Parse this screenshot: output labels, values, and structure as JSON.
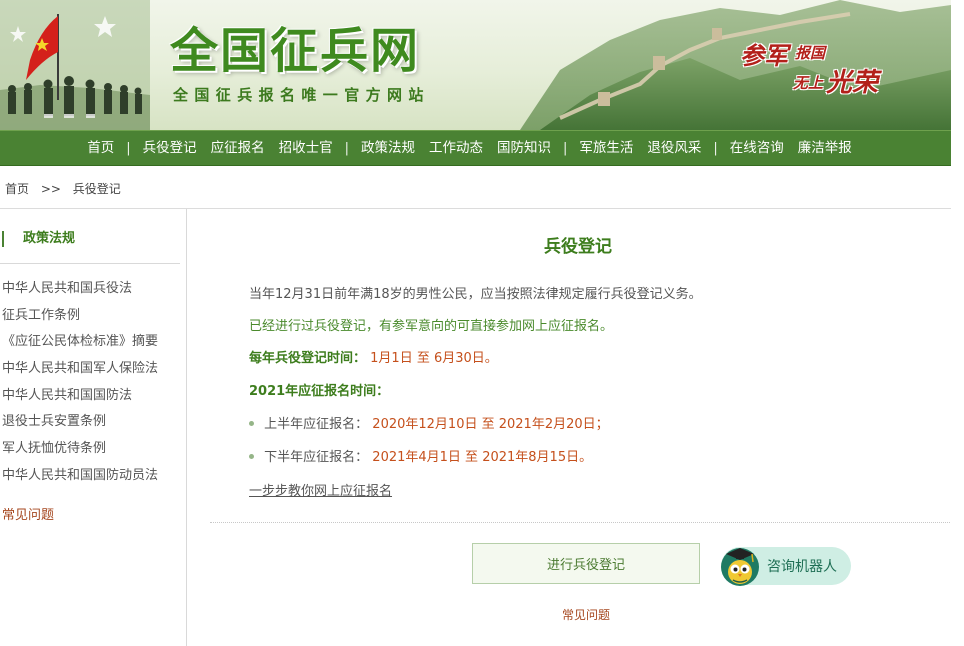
{
  "header": {
    "site_title": "全国征兵网",
    "site_subtitle": "全国征兵报名唯一官方网站",
    "slogan": {
      "part1": "参军",
      "part2": "报国",
      "part3": "无上",
      "part4": "光荣"
    }
  },
  "nav": {
    "items": [
      "首页",
      "兵役登记",
      "应征报名",
      "招收士官",
      "政策法规",
      "工作动态",
      "国防知识",
      "军旅生活",
      "退役风采",
      "在线咨询",
      "廉洁举报"
    ],
    "separator": "|"
  },
  "breadcrumb": {
    "home": "首页",
    "separator": ">>",
    "current": "兵役登记"
  },
  "sidebar": {
    "title": "政策法规",
    "items": [
      "中华人民共和国兵役法",
      "征兵工作条例",
      "《应征公民体检标准》摘要",
      "中华人民共和国军人保险法",
      "中华人民共和国国防法",
      "退役士兵安置条例",
      "军人抚恤优待条例",
      "中华人民共和国国防动员法"
    ],
    "faq": "常见问题"
  },
  "main": {
    "title": "兵役登记",
    "para1": "当年12月31日前年满18岁的男性公民，应当按照法律规定履行兵役登记义务。",
    "para2": "已经进行过兵役登记，有参军意向的可直接参加网上应征报名。",
    "registration_time_label": "每年兵役登记时间：",
    "registration_time_value": "1月1日 至 6月30日。",
    "enlist_time_heading": "2021年应征报名时间：",
    "first_half_label": "上半年应征报名：",
    "first_half_value": "2020年12月10日 至 2021年2月20日；",
    "second_half_label": "下半年应征报名：",
    "second_half_value": "2021年4月1日 至 2021年8月15日。",
    "guide_link": "一步步教你网上应征报名",
    "register_button": "进行兵役登记",
    "robot_button": "咨询机器人",
    "bottom_faq": "常见问题"
  },
  "colors": {
    "nav_bg": "#4a8233",
    "title_green": "#3d7d1d",
    "date_orange": "#c5501c",
    "faq_brown": "#a5461e",
    "slogan_red": "#b3201a"
  }
}
